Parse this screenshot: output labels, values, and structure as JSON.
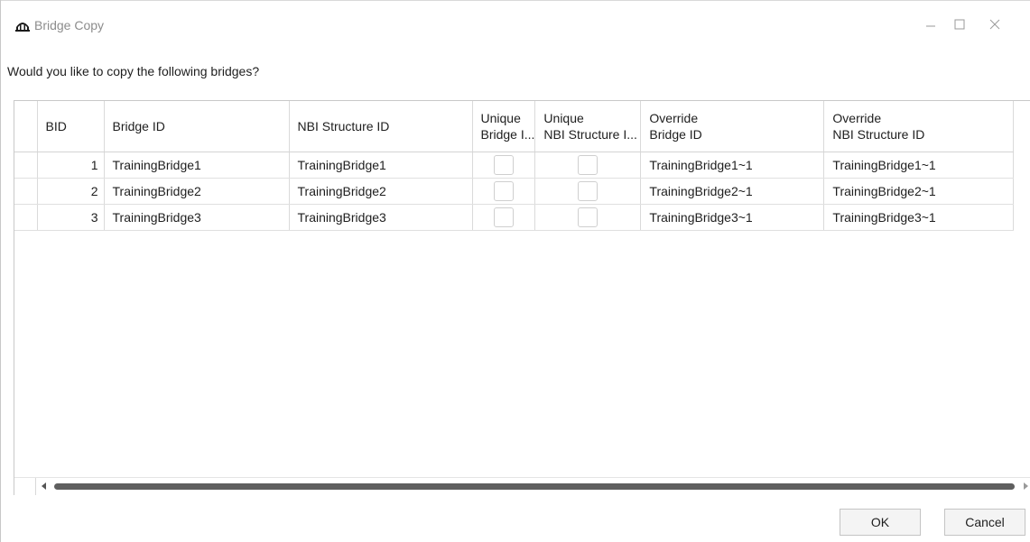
{
  "window": {
    "title": "Bridge Copy",
    "icon": "bridge-icon",
    "controls": [
      "minimize-icon",
      "maximize-icon",
      "close-icon"
    ]
  },
  "prompt": "Would you like to copy the following bridges?",
  "table": {
    "columns": [
      {
        "label": ""
      },
      {
        "label": "BID"
      },
      {
        "label": "Bridge ID"
      },
      {
        "label": "NBI Structure ID"
      },
      {
        "line1": "Unique",
        "line2": "Bridge I..."
      },
      {
        "line1": "Unique",
        "line2": "NBI Structure I..."
      },
      {
        "line1": "Override",
        "line2": "Bridge ID"
      },
      {
        "line1": "Override",
        "line2": "NBI Structure ID"
      }
    ],
    "rows": [
      {
        "bid": "1",
        "bridge_id": "TrainingBridge1",
        "nbi_id": "TrainingBridge1",
        "unique_bridge": false,
        "unique_nbi": false,
        "override_bridge_id": "TrainingBridge1~1",
        "override_nbi_id": "TrainingBridge1~1"
      },
      {
        "bid": "2",
        "bridge_id": "TrainingBridge2",
        "nbi_id": "TrainingBridge2",
        "unique_bridge": false,
        "unique_nbi": false,
        "override_bridge_id": "TrainingBridge2~1",
        "override_nbi_id": "TrainingBridge2~1"
      },
      {
        "bid": "3",
        "bridge_id": "TrainingBridge3",
        "nbi_id": "TrainingBridge3",
        "unique_bridge": false,
        "unique_nbi": false,
        "override_bridge_id": "TrainingBridge3~1",
        "override_nbi_id": "TrainingBridge3~1"
      }
    ]
  },
  "buttons": {
    "ok": "OK",
    "cancel": "Cancel"
  }
}
